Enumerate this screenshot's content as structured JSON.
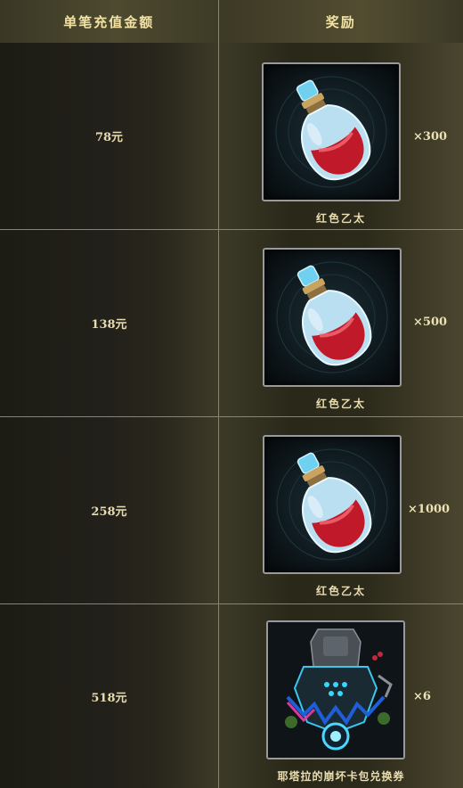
{
  "header": {
    "col_amount": "单笔充值金额",
    "col_reward": "奖励"
  },
  "rows": [
    {
      "amount": "78元",
      "reward_qty": "×300",
      "reward_name": "红色乙太",
      "reward_icon": "red-ether-potion-icon"
    },
    {
      "amount": "138元",
      "reward_qty": "×500",
      "reward_name": "红色乙太",
      "reward_icon": "red-ether-potion-icon"
    },
    {
      "amount": "258元",
      "reward_qty": "×1000",
      "reward_name": "红色乙太",
      "reward_icon": "red-ether-potion-icon"
    },
    {
      "amount": "518元",
      "reward_qty": "×6",
      "reward_name": "耶塔拉的崩坏卡包兑换券",
      "reward_icon": "card-pack-voucher-icon"
    }
  ],
  "colors": {
    "header_text": "#f2e2a4",
    "border": "#8f8657",
    "potion_red": "#c0192a",
    "potion_glass": "#7fd6f0"
  }
}
